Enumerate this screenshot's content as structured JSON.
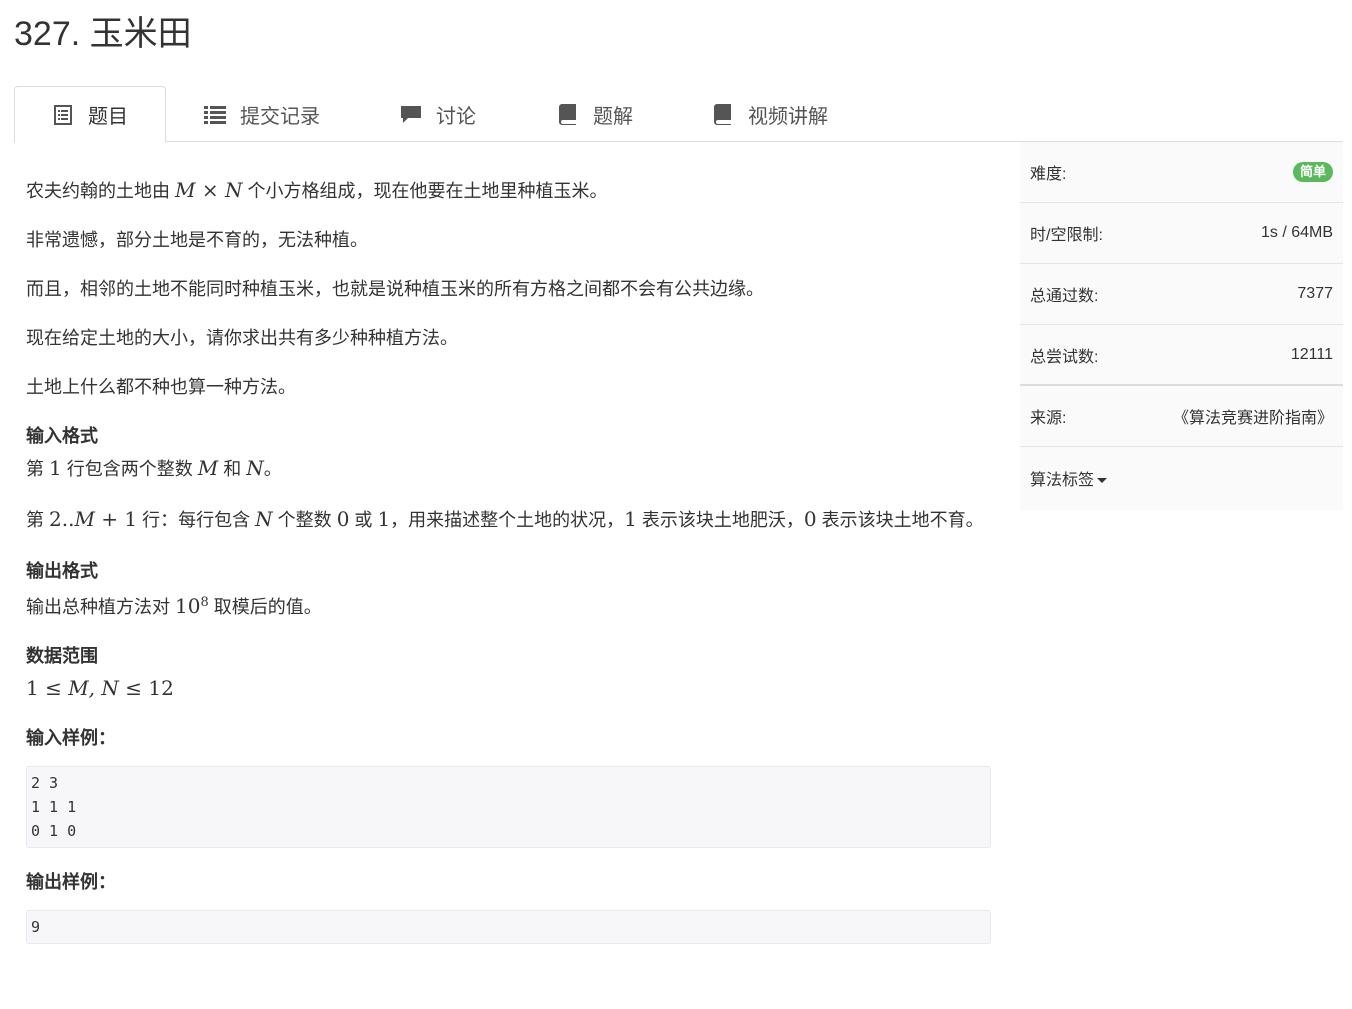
{
  "page": {
    "title": "327. 玉米田"
  },
  "tabs": [
    {
      "label": "题目",
      "icon": "document-icon",
      "active": true
    },
    {
      "label": "提交记录",
      "icon": "list-icon"
    },
    {
      "label": "讨论",
      "icon": "comment-icon"
    },
    {
      "label": "题解",
      "icon": "book-icon"
    },
    {
      "label": "视频讲解",
      "icon": "book-icon"
    }
  ],
  "problem": {
    "p1_a": "农夫约翰的土地由 ",
    "p1_m": "M",
    "p1_times": " × ",
    "p1_n": "N",
    "p1_b": " 个小方格组成，现在他要在土地里种植玉米。",
    "p2": "非常遗憾，部分土地是不育的，无法种植。",
    "p3": "而且，相邻的土地不能同时种植玉米，也就是说种植玉米的所有方格之间都不会有公共边缘。",
    "p4": "现在给定土地的大小，请你求出共有多少种种植方法。",
    "p5": "土地上什么都不种也算一种方法。",
    "input_head": "输入格式",
    "in1_a": "第 ",
    "in1_one": "1",
    "in1_b": " 行包含两个整数 ",
    "in1_m": "M",
    "in1_c": " 和 ",
    "in1_n": "N",
    "in1_d": "。",
    "in2_a": "第 ",
    "in2_range": "2..",
    "in2_m": "M",
    "in2_plus": " + 1",
    "in2_b": " 行：每行包含 ",
    "in2_n": "N",
    "in2_c": " 个整数 ",
    "in2_zero": "0",
    "in2_d": " 或 ",
    "in2_one": "1",
    "in2_e": "，用来描述整个土地的状况，",
    "in2_one2": "1",
    "in2_f": " 表示该块土地肥沃，",
    "in2_zero2": "0",
    "in2_g": " 表示该块土地不育。",
    "output_head": "输出格式",
    "out_a": "输出总种植方法对 ",
    "out_base": "10",
    "out_exp": "8",
    "out_b": " 取模后的值。",
    "range_head": "数据范围",
    "range_one": "1 ≤ ",
    "range_mn": "M, N",
    "range_rest": " ≤ 12",
    "sample_in_head": "输入样例：",
    "sample_in": "2 3\n1 1 1\n0 1 0",
    "sample_out_head": "输出样例：",
    "sample_out": "9"
  },
  "sidebar": {
    "difficulty_label": "难度:",
    "difficulty_value": "简单",
    "limit_label": "时/空限制:",
    "limit_value": "1s / 64MB",
    "passed_label": "总通过数:",
    "passed_value": "7377",
    "tried_label": "总尝试数:",
    "tried_value": "12111",
    "source_label": "来源:",
    "source_value": "《算法竞赛进阶指南》",
    "tags_label": "算法标签"
  },
  "colors": {
    "badge": "#5cb85c",
    "code_bg": "#f7f7f9",
    "sidebar_bg": "#fafafa"
  }
}
